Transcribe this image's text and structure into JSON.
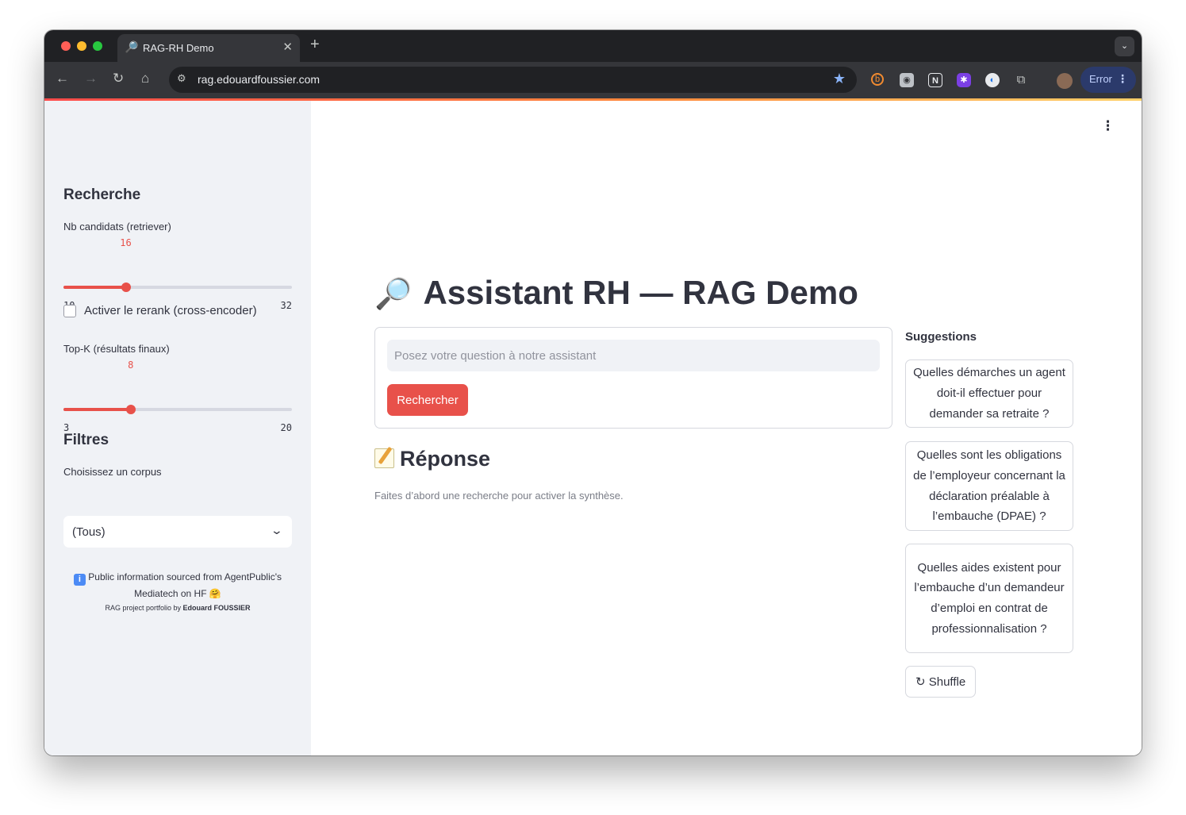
{
  "browser": {
    "tab_title": "RAG-RH Demo",
    "tab_favicon": "🔎",
    "tab_close": "✕",
    "new_tab": "+",
    "tabs_menu": "⌄",
    "url": "rag.edouardfoussier.com",
    "profile_status": "Error",
    "icons": [
      "back-arrow-icon",
      "forward-arrow-icon",
      "reload-icon",
      "home-icon",
      "site-info-icon",
      "bookmark-star-icon",
      "extension-icons",
      "puzzle-icon",
      "avatar",
      "kebab-icon"
    ]
  },
  "sidebar": {
    "search_heading": "Recherche",
    "retriever_slider": {
      "label": "Nb candidats (retriever)",
      "value": "16",
      "min": "10",
      "max": "32",
      "fraction": 0.2727
    },
    "rerank_checkbox": {
      "label": "Activer le rerank (cross-encoder)",
      "checked": false
    },
    "topk_slider": {
      "label": "Top-K (résultats finaux)",
      "value": "8",
      "min": "3",
      "max": "20",
      "fraction": 0.2941
    },
    "filters_heading": "Filtres",
    "corpus_select": {
      "label": "Choisissez un corpus",
      "value": "(Tous)"
    },
    "note_text": "Public information sourced from AgentPublic's Mediatech on HF 🤗",
    "note_icon": "i",
    "credit_prefix": "RAG project portfolio by ",
    "credit_author": "Edouard FOUSSIER"
  },
  "main": {
    "title_icon": "🔎",
    "title": "Assistant RH — RAG Demo",
    "query_placeholder": "Posez votre question à notre assistant",
    "search_button": "Rechercher",
    "answer_heading": "Réponse",
    "answer_hint": "Faites d’abord une recherche pour activer la synthèse.",
    "suggestions_heading": "Suggestions",
    "suggestions": [
      "Quelles démarches un agent doit-il effectuer pour demander sa retraite ?",
      "Quelles sont les obligations de l’employeur concernant la déclaration préalable à l’embauche (DPAE) ?",
      "Quelles aides existent pour l’embauche d’un demandeur d’emploi en contrat de professionnalisation ?"
    ],
    "shuffle_button": "↻ Shuffle"
  },
  "colors": {
    "accent": "#e8514a",
    "sidebar_bg": "#f0f2f6",
    "text": "#31333f"
  }
}
